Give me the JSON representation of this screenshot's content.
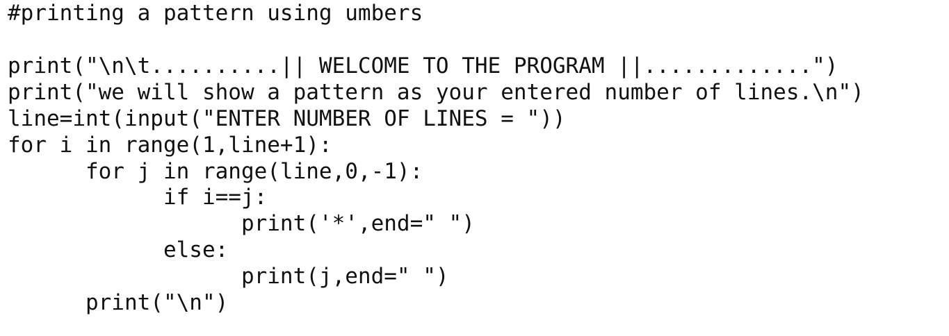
{
  "code": {
    "lines": [
      "#printing a pattern using umbers",
      "print(\"\\n\\t..........|| WELCOME TO THE PROGRAM ||.............\")",
      "print(\"we will show a pattern as your entered number of lines.\\n\")",
      "line=int(input(\"ENTER NUMBER OF LINES = \"))",
      "for i in range(1,line+1):",
      "      for j in range(line,0,-1):",
      "            if i==j:",
      "                  print('*',end=\" \")",
      "            else:",
      "                  print(j,end=\" \")",
      "      print(\"\\n\")"
    ]
  }
}
